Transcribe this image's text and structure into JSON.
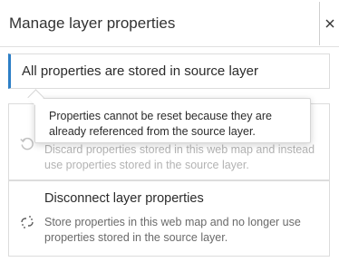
{
  "header": {
    "title": "Manage layer properties",
    "close_icon": "close-icon"
  },
  "notice": {
    "text": "All properties are stored in source layer",
    "accent_color": "#2c7ec6"
  },
  "tooltip": {
    "text": "Properties cannot be reset because they are already referenced from the source layer."
  },
  "options": [
    {
      "icon": "reset-icon",
      "description": "Discard properties stored in this web map and instead use properties stored in the source layer.",
      "disabled": true
    },
    {
      "title": "Disconnect layer properties",
      "icon": "disconnect-icon",
      "description": "Store properties in this web map and no longer use properties stored in the source layer.",
      "disabled": false
    }
  ]
}
